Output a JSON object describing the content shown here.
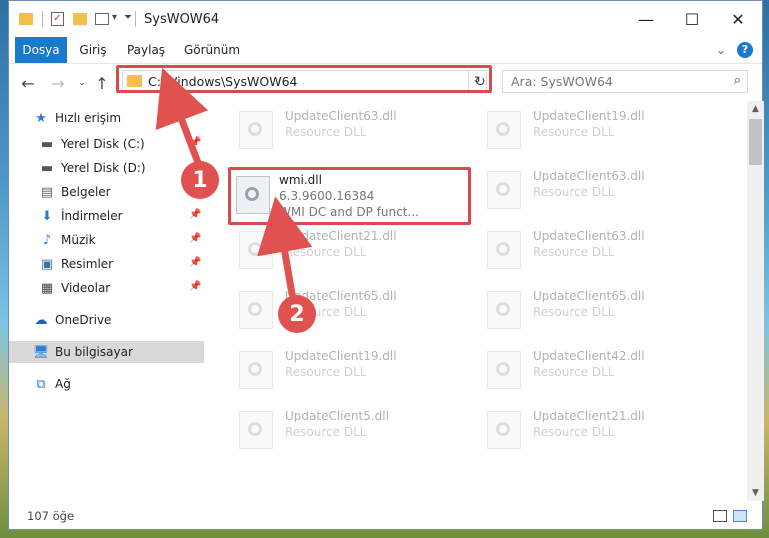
{
  "window": {
    "title": "SysWOW64",
    "controls": {
      "minimize": "—",
      "maximize": "☐",
      "close": "✕"
    }
  },
  "ribbon": {
    "tabs": [
      "Dosya",
      "Giriş",
      "Paylaş",
      "Görünüm"
    ],
    "chevron": "⌄",
    "help": "?"
  },
  "nav": {
    "address": "C:\\Windows\\SysWOW64",
    "search_placeholder": "Ara: SysWOW64"
  },
  "sidebar": {
    "items": [
      {
        "label": "Hızlı erişim",
        "icon": "star-icon",
        "pinned": false
      },
      {
        "label": "Yerel Disk (C:)",
        "icon": "drive-icon",
        "pinned": true
      },
      {
        "label": "Yerel Disk (D:)",
        "icon": "drive-icon",
        "pinned": true
      },
      {
        "label": "Belgeler",
        "icon": "documents-icon",
        "pinned": true
      },
      {
        "label": "İndirmeler",
        "icon": "downloads-icon",
        "pinned": true
      },
      {
        "label": "Müzik",
        "icon": "music-icon",
        "pinned": true
      },
      {
        "label": "Resimler",
        "icon": "pictures-icon",
        "pinned": true
      },
      {
        "label": "Videolar",
        "icon": "videos-icon",
        "pinned": true
      },
      {
        "label": "OneDrive",
        "icon": "cloud-icon",
        "pinned": false
      },
      {
        "label": "Bu bilgisayar",
        "icon": "computer-icon",
        "pinned": false
      },
      {
        "label": "Ağ",
        "icon": "network-icon",
        "pinned": false
      }
    ]
  },
  "files": {
    "left": [
      {
        "name": "UpdateClient63.dll",
        "desc": "Resource DLL"
      },
      {
        "name": "wmi.dll",
        "desc": "6.3.9600.16384",
        "desc2": "WMI DC and DP funct..."
      },
      {
        "name": "UpdateClient21.dll",
        "desc": "Resource DLL"
      },
      {
        "name": "UpdateClient65.dll",
        "desc": "Resource DLL"
      },
      {
        "name": "UpdateClient19.dll",
        "desc": "Resource DLL"
      },
      {
        "name": "UpdateClient5.dll",
        "desc": "Resource DLL"
      }
    ],
    "right": [
      {
        "name": "UpdateClient19.dll",
        "desc": "Resource DLL"
      },
      {
        "name": "UpdateClient63.dll",
        "desc": "Resource DLL"
      },
      {
        "name": "UpdateClient63.dll",
        "desc": "Resource DLL"
      },
      {
        "name": "UpdateClient65.dll",
        "desc": "Resource DLL"
      },
      {
        "name": "UpdateClient42.dll",
        "desc": "Resource DLL"
      },
      {
        "name": "UpdateClient21.dll",
        "desc": "Resource DLL"
      }
    ]
  },
  "status": {
    "count": "107 öğe"
  },
  "callouts": {
    "one": "1",
    "two": "2"
  },
  "colors": {
    "accent": "#1979ca",
    "callout": "#e0524f",
    "highlight": "#d94b4b"
  }
}
